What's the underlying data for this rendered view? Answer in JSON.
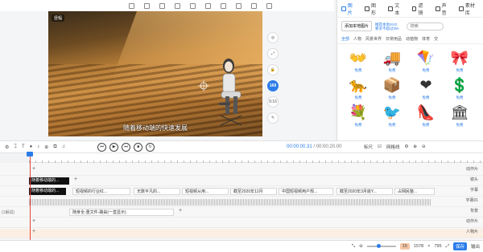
{
  "stage": {
    "tag": "竖幅",
    "caption": "随着移动端的快速发展",
    "side_tools": [
      "",
      "",
      "",
      "169",
      "9:16",
      ""
    ]
  },
  "panel": {
    "tabs": [
      {
        "label": "图片",
        "icon": "image-icon"
      },
      {
        "label": "图形",
        "icon": "shape-icon"
      },
      {
        "label": "文本",
        "icon": "text-icon"
      },
      {
        "label": "滤镜",
        "icon": "filter-icon"
      },
      {
        "label": "声音",
        "icon": "sound-icon"
      },
      {
        "label": "素材库",
        "icon": "library-icon"
      }
    ],
    "add_local": "添加本地图片",
    "svg_line1": "推荐本地SVG",
    "svg_line2": "要求不超过2M",
    "search_placeholder": "搜索",
    "categories": [
      "全部",
      "人物",
      "风景世界",
      "日常用品",
      "动植物",
      "体育",
      "交"
    ],
    "free_label": "免费",
    "items": [
      {
        "glyph": "👐",
        "name": "hands"
      },
      {
        "glyph": "🚚",
        "name": "truck"
      },
      {
        "glyph": "🪁",
        "name": "kite"
      },
      {
        "glyph": "🎀",
        "name": "banner"
      },
      {
        "glyph": "🐆",
        "name": "leopard"
      },
      {
        "glyph": "📦",
        "name": "box"
      },
      {
        "glyph": "❤",
        "name": "heart"
      },
      {
        "glyph": "💲",
        "name": "dollar-coin"
      },
      {
        "glyph": "💐",
        "name": "bouquet"
      },
      {
        "glyph": "🐦",
        "name": "bird"
      },
      {
        "glyph": "👠",
        "name": "high-heel"
      },
      {
        "glyph": "🏛",
        "name": "building"
      }
    ]
  },
  "controls": {
    "current_time": "00:00:00.31",
    "separator": " / ",
    "total_time": "00:00:20.00",
    "marker_label": "标尺",
    "grid_label": "网格线"
  },
  "tracks": {
    "camera_label": "镜头",
    "dark_clip": "随着移动端的...",
    "subtitles": [
      "短视频的行业红...",
      "无数平凡的...",
      "短视频从用...",
      "截至2020年12月",
      "中国短视频用户规...",
      "截至2020年3月底Y...",
      "占网民整..."
    ],
    "audio_note": "随身全-重文件-路由(一直显示)",
    "right_labels": [
      "动作片",
      "镜头",
      "字幕",
      "字幕01",
      "背景",
      "动作片",
      "人物片"
    ],
    "left_labels": [
      "",
      "",
      "",
      "(1解说)",
      "",
      ""
    ]
  },
  "status": {
    "percent": "15",
    "width": "1578",
    "height": "795",
    "save": "保存",
    "export": "输出"
  }
}
